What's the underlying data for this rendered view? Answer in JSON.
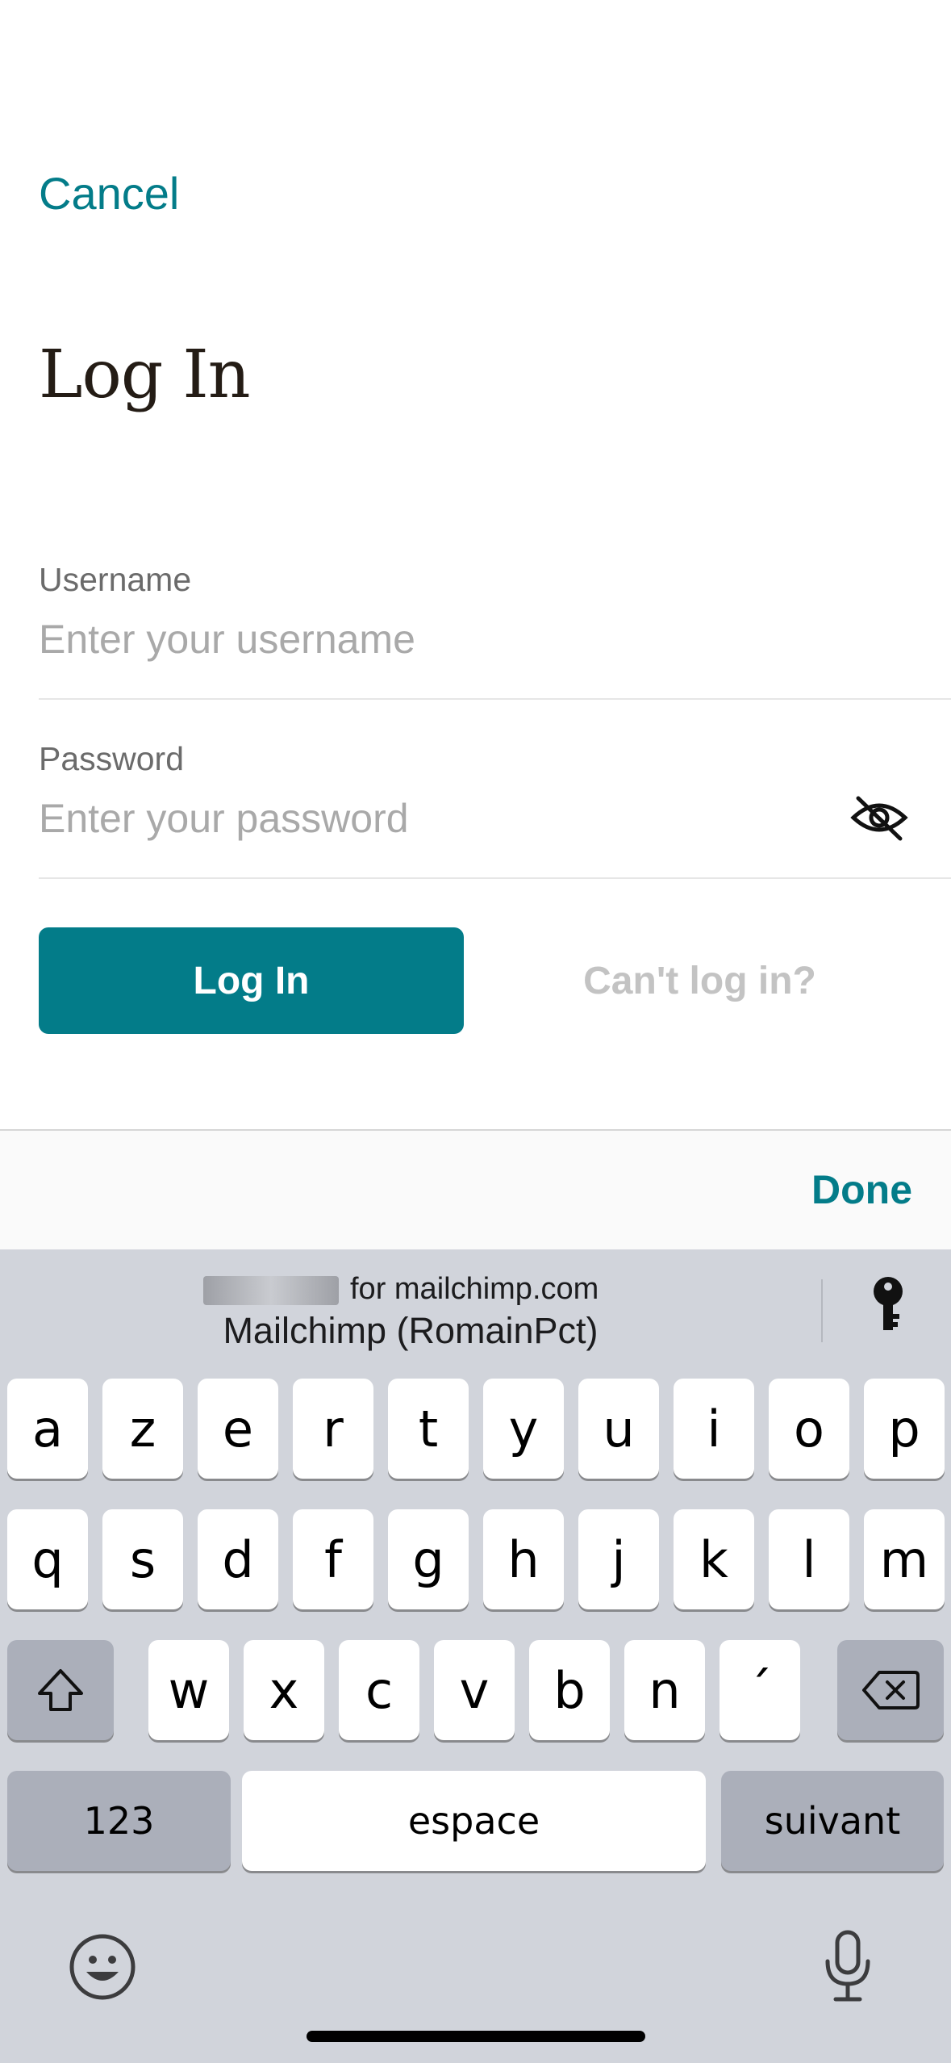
{
  "header": {
    "cancel_label": "Cancel",
    "title": "Log In"
  },
  "form": {
    "username": {
      "label": "Username",
      "placeholder": "Enter your username",
      "value": ""
    },
    "password": {
      "label": "Password",
      "placeholder": "Enter your password",
      "value": ""
    },
    "login_button": "Log In",
    "cant_login_link": "Can't log in?"
  },
  "accessory_bar": {
    "done_label": "Done"
  },
  "keyboard": {
    "suggestion": {
      "domain": "for mailchimp.com",
      "account": "Mailchimp (RomainPct)"
    },
    "row1": [
      "a",
      "z",
      "e",
      "r",
      "t",
      "y",
      "u",
      "i",
      "o",
      "p"
    ],
    "row2": [
      "q",
      "s",
      "d",
      "f",
      "g",
      "h",
      "j",
      "k",
      "l",
      "m"
    ],
    "row3": [
      "w",
      "x",
      "c",
      "v",
      "b",
      "n",
      "´"
    ],
    "numbers_label": "123",
    "space_label": "espace",
    "return_label": "suivant"
  },
  "colors": {
    "accent": "#037c89",
    "keyboard_bg": "#d1d4db"
  },
  "icons": [
    "eye-slash-icon",
    "key-icon",
    "shift-icon",
    "delete-icon",
    "emoji-icon",
    "microphone-icon"
  ]
}
